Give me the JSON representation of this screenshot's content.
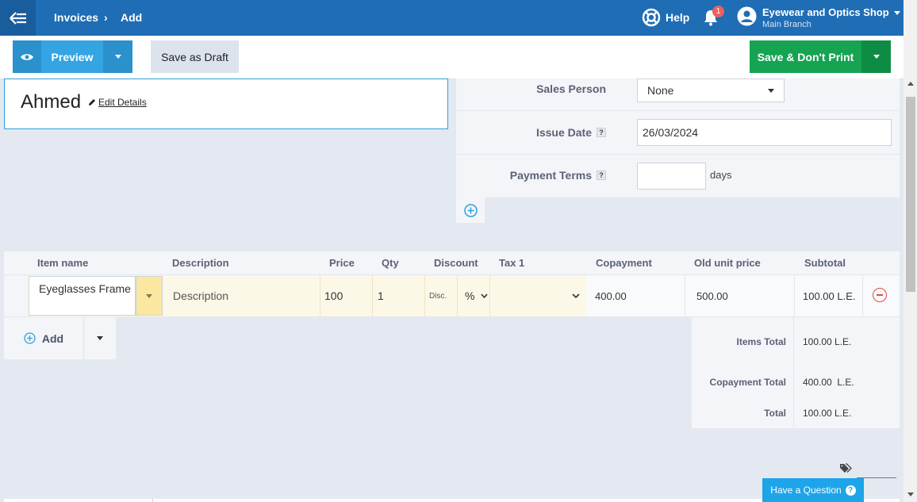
{
  "header": {
    "breadcrumb": [
      "Invoices",
      "Add"
    ],
    "breadcrumb_separator": "›",
    "help_label": "Help",
    "notifications_count": "1",
    "account_name": "Eyewear and Optics Shop",
    "account_branch": "Main Branch"
  },
  "toolbar": {
    "preview_label": "Preview",
    "draft_label": "Save as Draft",
    "save_label": "Save & Don't Print"
  },
  "client": {
    "name": "Ahmed",
    "edit_label": "Edit Details"
  },
  "form": {
    "sales_person_label": "Sales Person",
    "sales_person_value": "None",
    "issue_date_label": "Issue Date",
    "issue_date_value": "26/03/2024",
    "payment_terms_label": "Payment Terms",
    "payment_terms_value": "",
    "payment_terms_unit": "days",
    "help_glyph": "?"
  },
  "table": {
    "columns": [
      "Item name",
      "Description",
      "Price",
      "Qty",
      "Discount",
      "Tax 1",
      "Copayment",
      "Old unit price",
      "Subtotal"
    ],
    "row": {
      "item_name": "Eyeglasses Frame",
      "description_placeholder": "Description",
      "price": "100",
      "qty": "1",
      "discount_placeholder": "Disc.",
      "discount_type": "%",
      "tax": "",
      "copayment": "400.00",
      "old_unit_price": "500.00",
      "subtotal": "100.00 L.E."
    },
    "add_label": "Add"
  },
  "totals": {
    "items_total_label": "Items Total",
    "items_total_value": "100.00 L.E.",
    "copayment_total_label": "Copayment Total",
    "copayment_total_value": "400.00  L.E.",
    "total_label": "Total",
    "total_value": "100.00 L.E."
  },
  "support": {
    "question_label": "Have a Question"
  },
  "colors": {
    "topbar": "#1f6db5",
    "preview": "#34a4e3",
    "save": "#16a352",
    "row_highlight": "#fbf8e7"
  }
}
